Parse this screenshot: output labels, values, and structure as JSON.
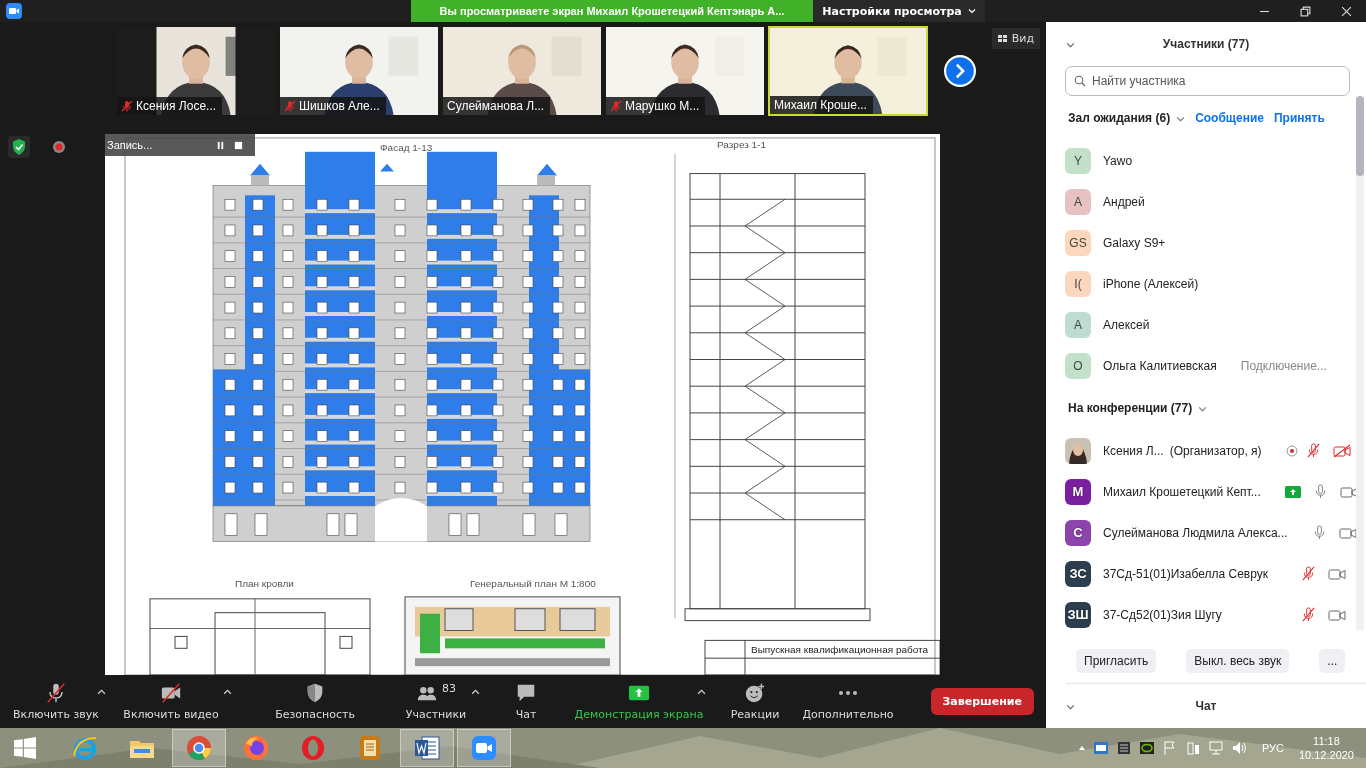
{
  "top_bar": {
    "banner": "Вы просматриваете экран Михаил Крошетецкий Кептэнарь А...",
    "view_options": "Настройки просмотра"
  },
  "video_tiles": [
    {
      "name": "Ксения Лосе...",
      "muted": true,
      "speaking": false
    },
    {
      "name": "Шишков Але...",
      "muted": true,
      "speaking": false
    },
    {
      "name": "Сулейманова Л...",
      "muted": false,
      "speaking": false
    },
    {
      "name": "Марушко М...",
      "muted": true,
      "speaking": false
    },
    {
      "name": "Михаил Кроше...",
      "muted": false,
      "speaking": true
    }
  ],
  "view_button": "Вид",
  "recording": {
    "label": "Запись..."
  },
  "shared_document": {
    "facade_title": "Фасад 1-13",
    "section_title": "Разрез 1-1",
    "roof_plan_title": "План кровли",
    "site_plan_title": "Генеральный план М 1:800",
    "title_block": "Выпускная квалификационная работа"
  },
  "toolbar": {
    "items": [
      {
        "kind": "audio",
        "label": "Включить звук",
        "crossed": true,
        "caret": true,
        "active": false
      },
      {
        "kind": "video",
        "label": "Включить видео",
        "crossed": true,
        "caret": true,
        "active": false
      },
      {
        "kind": "security",
        "label": "Безопасность",
        "crossed": false,
        "caret": false,
        "active": false
      },
      {
        "kind": "participants",
        "label": "Участники",
        "count": "83",
        "crossed": false,
        "caret": true,
        "active": false
      },
      {
        "kind": "chat",
        "label": "Чат",
        "crossed": false,
        "caret": false,
        "active": false
      },
      {
        "kind": "share",
        "label": "Демонстрация экрана",
        "crossed": false,
        "caret": true,
        "active": true
      },
      {
        "kind": "reactions",
        "label": "Реакции",
        "crossed": false,
        "caret": false,
        "active": false
      },
      {
        "kind": "more",
        "label": "Дополнительно",
        "crossed": false,
        "caret": false,
        "active": false
      }
    ],
    "end_button": "Завершение"
  },
  "participants_panel": {
    "title": "Участники (77)",
    "search_placeholder": "Найти участника",
    "waiting": {
      "title": "Зал ожидания (6)",
      "message": "Сообщение",
      "admit": "Принять",
      "people": [
        {
          "initials": "Y",
          "name": "Yawo",
          "color": "#c3e0c8"
        },
        {
          "initials": "А",
          "name": "Андрей",
          "color": "#e6c2c2"
        },
        {
          "initials": "GS",
          "name": "Galaxy S9+",
          "color": "#fcd6bd"
        },
        {
          "initials": "I(",
          "name": "iPhone (Алексей)",
          "color": "#fcd6bd"
        },
        {
          "initials": "А",
          "name": "Алексей",
          "color": "#bedcd2"
        },
        {
          "initials": "О",
          "name": "Ольга Калитиевская",
          "color": "#c3e0c8",
          "status": "Подключение..."
        }
      ]
    },
    "in_meeting": {
      "title": "На конференции (77)",
      "people": [
        {
          "name": "Ксения Л...",
          "role": "(Организатор, я)",
          "recording": true,
          "sharing": false,
          "mic_muted": true,
          "video_muted": true
        },
        {
          "kind": "initials",
          "initials": "М",
          "color": "#7a1fa0",
          "name": "Михаил Крошетецкий Кепт...",
          "recording": false,
          "sharing": true,
          "mic_muted": false,
          "video_muted": false
        },
        {
          "kind": "initials",
          "initials": "С",
          "color": "#8e44ad",
          "name": "Сулейманова Людмила Алекса...",
          "recording": false,
          "sharing": false,
          "mic_muted": false,
          "video_muted": false
        },
        {
          "kind": "initials",
          "initials": "ЗС",
          "color": "#2d3e50",
          "name": "37Сд-51(01)Изабелла Севрук",
          "recording": false,
          "sharing": false,
          "mic_muted": true,
          "video_muted": false
        },
        {
          "kind": "initials",
          "initials": "ЗШ",
          "color": "#2d3e50",
          "name": "37-Сд52(01)Зия Шугу",
          "recording": false,
          "sharing": false,
          "mic_muted": true,
          "video_muted": false
        }
      ]
    },
    "buttons": [
      "Пригласить",
      "Выкл. весь звук",
      "..."
    ],
    "chat_title": "Чат"
  },
  "taskbar": {
    "apps": [
      {
        "kind": "ie",
        "selected": false
      },
      {
        "kind": "folder",
        "selected": false
      },
      {
        "kind": "chrome",
        "selected": true
      },
      {
        "kind": "firefox",
        "selected": false
      },
      {
        "kind": "opera",
        "selected": false
      },
      {
        "kind": "book",
        "selected": false
      },
      {
        "kind": "word",
        "selected": true
      },
      {
        "kind": "zoom",
        "selected": true
      }
    ],
    "language": "РУС",
    "time": "11:18",
    "date": "10.12.2020"
  }
}
